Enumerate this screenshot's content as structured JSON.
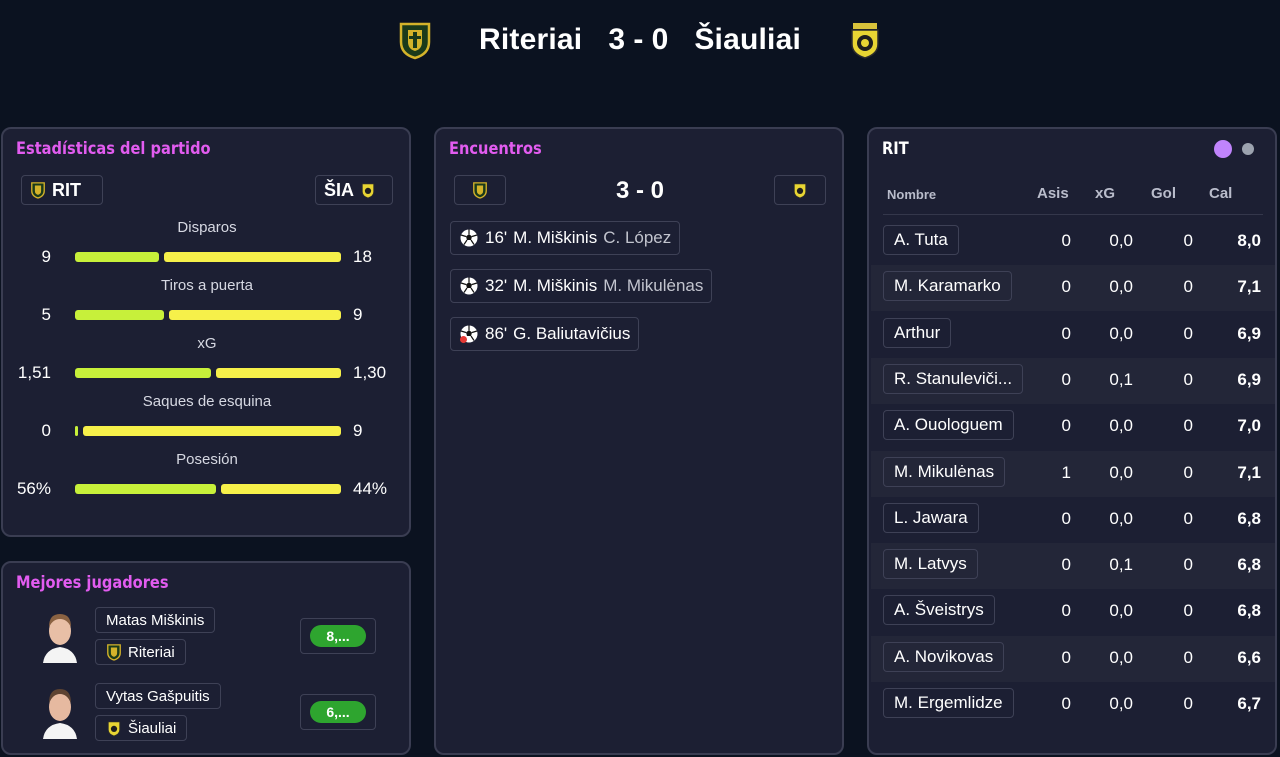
{
  "header": {
    "home_team": "Riteriai",
    "away_team": "Šiauliai",
    "score": "3 - 0"
  },
  "stats": {
    "title": "Estadísticas del partido",
    "home_abbr": "RIT",
    "away_abbr": "ŠIA",
    "rows": [
      {
        "label": "Disparos",
        "home": "9",
        "away": "18",
        "home_share": 0.32
      },
      {
        "label": "Tiros a puerta",
        "home": "5",
        "away": "9",
        "home_share": 0.34
      },
      {
        "label": "xG",
        "home": "1,51",
        "away": "1,30",
        "home_share": 0.52
      },
      {
        "label": "Saques de esquina",
        "home": "0",
        "away": "9",
        "home_share": 0.0
      },
      {
        "label": "Posesión",
        "home": "56%",
        "away": "44%",
        "home_share": 0.54
      }
    ]
  },
  "top_players": {
    "title": "Mejores jugadores",
    "players": [
      {
        "name": "Matas Miškinis",
        "team": "Riteriai",
        "rating": "8,...",
        "rating_color": "#2ea52f"
      },
      {
        "name": "Vytas Gašpuitis",
        "team": "Šiauliai",
        "rating": "6,...",
        "rating_color": "#2ea52f"
      }
    ]
  },
  "events": {
    "title": "Encuentros",
    "score": "3 - 0",
    "items": [
      {
        "minute": "16'",
        "scorer": "M. Miškinis",
        "assist": "C. López",
        "icon": "soccer-ball-icon"
      },
      {
        "minute": "32'",
        "scorer": "M. Miškinis",
        "assist": "M. Mikulėnas",
        "icon": "soccer-ball-icon"
      },
      {
        "minute": "86'",
        "scorer": "G. Baliutavičius",
        "assist": "",
        "icon": "own-goal-ball-icon"
      }
    ]
  },
  "lineup": {
    "team": "RIT",
    "headers": {
      "name": "Nombre",
      "assists": "Asis",
      "xg": "xG",
      "goals": "Gol",
      "rating": "Cal"
    },
    "active_dot_color": "#c084fc",
    "inactive_dot_color": "#9ca3af",
    "players": [
      {
        "name": "A. Tuta",
        "assists": "0",
        "xg": "0,0",
        "goals": "0",
        "rating": "8,0"
      },
      {
        "name": "M. Karamarko",
        "assists": "0",
        "xg": "0,0",
        "goals": "0",
        "rating": "7,1"
      },
      {
        "name": "Arthur",
        "assists": "0",
        "xg": "0,0",
        "goals": "0",
        "rating": "6,9"
      },
      {
        "name": "R. Stanuleviči...",
        "assists": "0",
        "xg": "0,1",
        "goals": "0",
        "rating": "6,9"
      },
      {
        "name": "A. Ouologuem",
        "assists": "0",
        "xg": "0,0",
        "goals": "0",
        "rating": "7,0"
      },
      {
        "name": "M. Mikulėnas",
        "assists": "1",
        "xg": "0,0",
        "goals": "0",
        "rating": "7,1"
      },
      {
        "name": "L. Jawara",
        "assists": "0",
        "xg": "0,0",
        "goals": "0",
        "rating": "6,8"
      },
      {
        "name": "M. Latvys",
        "assists": "0",
        "xg": "0,1",
        "goals": "0",
        "rating": "6,8"
      },
      {
        "name": "A. Šveistrys",
        "assists": "0",
        "xg": "0,0",
        "goals": "0",
        "rating": "6,8"
      },
      {
        "name": "A. Novikovas",
        "assists": "0",
        "xg": "0,0",
        "goals": "0",
        "rating": "6,6"
      },
      {
        "name": "M. Ergemlidze",
        "assists": "0",
        "xg": "0,0",
        "goals": "0",
        "rating": "6,7"
      }
    ]
  }
}
